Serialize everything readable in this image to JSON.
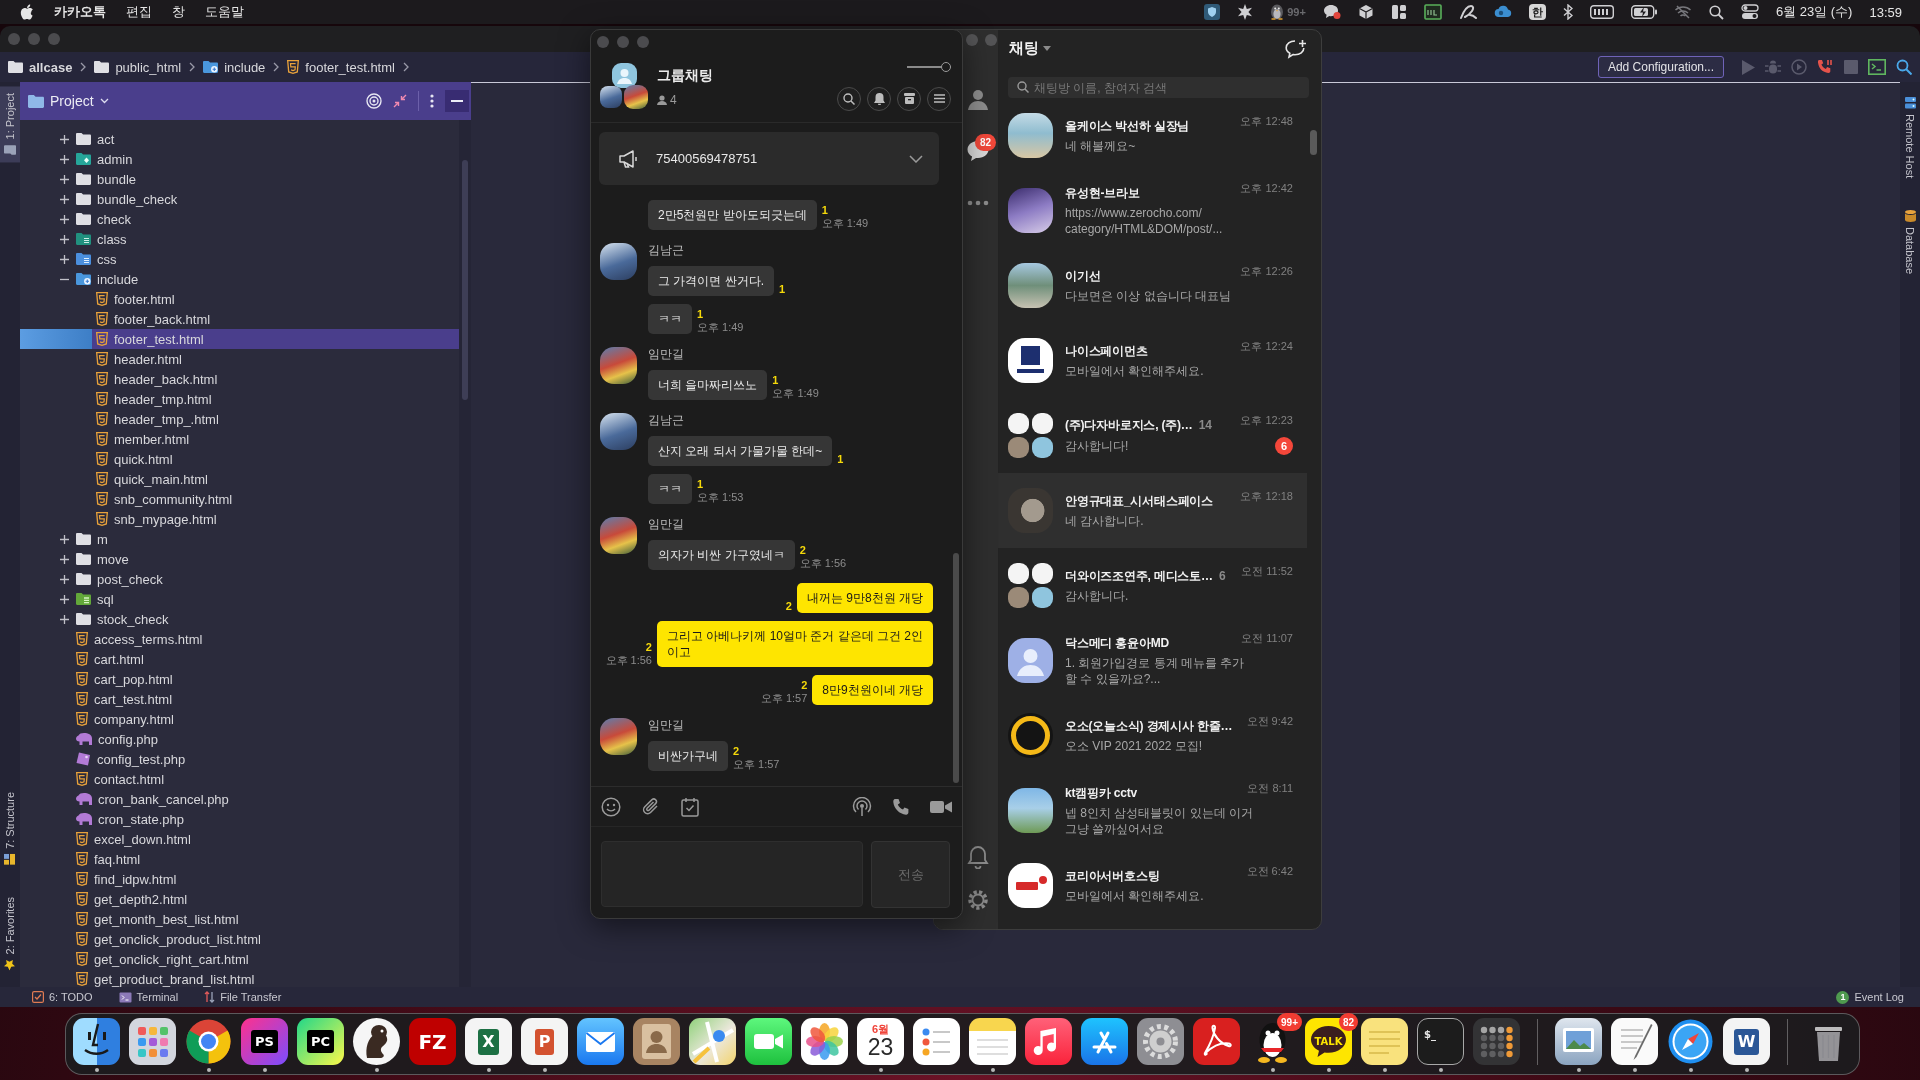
{
  "menu_bar": {
    "app": "카카오톡",
    "menus": [
      "편집",
      "창",
      "도움말"
    ],
    "status_icons": [
      {
        "kind": "shield"
      },
      {
        "kind": "spark"
      },
      {
        "kind": "penguin",
        "badge": "99+"
      },
      {
        "kind": "chat"
      },
      {
        "kind": "cube"
      },
      {
        "kind": "panels"
      },
      {
        "kind": "monitor"
      },
      {
        "kind": "swoosh"
      },
      {
        "kind": "cloud"
      },
      {
        "kind": "input",
        "label": "한"
      },
      {
        "kind": "bluetooth"
      },
      {
        "kind": "meter"
      },
      {
        "kind": "battery"
      },
      {
        "kind": "wifi_off"
      },
      {
        "kind": "search"
      },
      {
        "kind": "toggles"
      }
    ],
    "date": "6월 23일 (수)",
    "time": "13:59"
  },
  "ide": {
    "breadcrumb": [
      {
        "label": "allcase",
        "kind": "root"
      },
      {
        "label": "public_html",
        "kind": "folder"
      },
      {
        "label": "include",
        "kind": "module"
      },
      {
        "label": "footer_test.html",
        "kind": "html"
      }
    ],
    "run_config": "Add Configuration...",
    "toolbar": [
      {
        "kind": "run",
        "disabled": true
      },
      {
        "kind": "debug",
        "disabled": true
      },
      {
        "kind": "coverage",
        "disabled": true
      },
      {
        "kind": "attach",
        "disabled": false
      },
      {
        "kind": "stop",
        "disabled": true
      },
      {
        "kind": "terminal",
        "disabled": false
      },
      {
        "kind": "search",
        "disabled": false
      }
    ],
    "left_tools": {
      "top": [
        {
          "label": "1: Project",
          "kind": "project",
          "selected": true
        }
      ],
      "bottom": [
        {
          "label": "7: Structure",
          "kind": "structure",
          "selected": false
        },
        {
          "label": "2: Favorites",
          "kind": "favorites",
          "selected": false
        }
      ]
    },
    "right_tools": [
      {
        "label": "Remote Host",
        "kind": "remote",
        "selected": false
      },
      {
        "label": "Database",
        "kind": "database",
        "selected": false
      }
    ],
    "project_panel": {
      "title": "Project",
      "tree": [
        {
          "label": "act",
          "kind": "folder",
          "expanded": false,
          "selected": false
        },
        {
          "label": "admin",
          "kind": "folder_web",
          "expanded": false,
          "selected": false
        },
        {
          "label": "bundle",
          "kind": "folder",
          "expanded": false,
          "selected": false
        },
        {
          "label": "bundle_check",
          "kind": "folder",
          "expanded": false,
          "selected": false
        },
        {
          "label": "check",
          "kind": "folder",
          "expanded": false,
          "selected": false
        },
        {
          "label": "class",
          "kind": "folder_lib",
          "expanded": false,
          "selected": false
        },
        {
          "label": "css",
          "kind": "folder_css",
          "expanded": false,
          "selected": false
        },
        {
          "label": "include",
          "kind": "folder_module",
          "expanded": true,
          "selected": false,
          "children": [
            {
              "label": "footer.html",
              "kind": "html",
              "selected": false
            },
            {
              "label": "footer_back.html",
              "kind": "html",
              "selected": false
            },
            {
              "label": "footer_test.html",
              "kind": "html",
              "selected": true
            },
            {
              "label": "header.html",
              "kind": "html",
              "selected": false
            },
            {
              "label": "header_back.html",
              "kind": "html",
              "selected": false
            },
            {
              "label": "header_tmp.html",
              "kind": "html",
              "selected": false
            },
            {
              "label": "header_tmp_.html",
              "kind": "html",
              "selected": false
            },
            {
              "label": "member.html",
              "kind": "html",
              "selected": false
            },
            {
              "label": "quick.html",
              "kind": "html",
              "selected": false
            },
            {
              "label": "quick_main.html",
              "kind": "html",
              "selected": false
            },
            {
              "label": "snb_community.html",
              "kind": "html",
              "selected": false
            },
            {
              "label": "snb_mypage.html",
              "kind": "html",
              "selected": false
            }
          ]
        },
        {
          "label": "m",
          "kind": "folder",
          "expanded": false,
          "selected": false
        },
        {
          "label": "move",
          "kind": "folder",
          "expanded": false,
          "selected": false
        },
        {
          "label": "post_check",
          "kind": "folder",
          "expanded": false,
          "selected": false
        },
        {
          "label": "sql",
          "kind": "folder_db",
          "expanded": false,
          "selected": false
        },
        {
          "label": "stock_check",
          "kind": "folder",
          "expanded": false,
          "selected": false
        },
        {
          "label": "access_terms.html",
          "kind": "html",
          "selected": false
        },
        {
          "label": "cart.html",
          "kind": "html",
          "selected": false
        },
        {
          "label": "cart_pop.html",
          "kind": "html",
          "selected": false
        },
        {
          "label": "cart_test.html",
          "kind": "html",
          "selected": false
        },
        {
          "label": "company.html",
          "kind": "html",
          "selected": false
        },
        {
          "label": "config.php",
          "kind": "php",
          "selected": false
        },
        {
          "label": "config_test.php",
          "kind": "php_config",
          "selected": false
        },
        {
          "label": "contact.html",
          "kind": "html",
          "selected": false
        },
        {
          "label": "cron_bank_cancel.php",
          "kind": "php",
          "selected": false
        },
        {
          "label": "cron_state.php",
          "kind": "php",
          "selected": false
        },
        {
          "label": "excel_down.html",
          "kind": "html",
          "selected": false
        },
        {
          "label": "faq.html",
          "kind": "html",
          "selected": false
        },
        {
          "label": "find_idpw.html",
          "kind": "html",
          "selected": false
        },
        {
          "label": "get_depth2.html",
          "kind": "html",
          "selected": false
        },
        {
          "label": "get_month_best_list.html",
          "kind": "html",
          "selected": false
        },
        {
          "label": "get_onclick_product_list.html",
          "kind": "html",
          "selected": false
        },
        {
          "label": "get_onclick_right_cart.html",
          "kind": "html",
          "selected": false
        },
        {
          "label": "get_product_brand_list.html",
          "kind": "html",
          "selected": false
        }
      ]
    },
    "status_bar": {
      "tools": [
        {
          "label": "6: TODO",
          "kind": "todo",
          "selected": false
        },
        {
          "label": "Terminal",
          "kind": "terminal",
          "selected": false
        },
        {
          "label": "File Transfer",
          "kind": "transfer",
          "selected": false
        }
      ],
      "event_log": {
        "label": "Event Log",
        "count": "1"
      }
    }
  },
  "chat_list": {
    "sidebar": {
      "top": [
        {
          "kind": "friends"
        },
        {
          "kind": "chats",
          "badge": "82"
        },
        {
          "kind": "more"
        }
      ],
      "bottom": [
        {
          "kind": "bell"
        },
        {
          "kind": "settings"
        }
      ]
    },
    "title": "채팅",
    "search": {
      "placeholder": "채팅방 이름, 참여자 검색"
    },
    "rooms": [
      {
        "name": "올케이스 박선하 실장님",
        "preview": "네 해볼께요~",
        "time": "오후 12:48",
        "avatar": {
          "kind": "photo_beach"
        },
        "selected": false
      },
      {
        "name": "유성현-브라보",
        "preview": "https://www.zerocho.com/\ncategory/HTML&DOM/post/...",
        "time": "오후 12:42",
        "avatar": {
          "kind": "photo_sky"
        },
        "selected": false
      },
      {
        "name": "이기선",
        "preview": "다보면은 이상 없습니다 대표님",
        "time": "오후 12:26",
        "avatar": {
          "kind": "photo_mountain"
        },
        "selected": false
      },
      {
        "name": "나이스페이먼츠",
        "preview": "모바일에서 확인해주세요.",
        "time": "오후 12:24",
        "avatar": {
          "kind": "logo_tile"
        },
        "selected": false
      },
      {
        "name": "(주)다자바로지스, (주)…",
        "members": "14",
        "preview": "감사합니다!",
        "time": "오후 12:23",
        "unread": "6",
        "avatar": {
          "kind": "group"
        },
        "selected": false
      },
      {
        "name": "안영규대표_시서태스페이스",
        "preview": "네 감사합니다.",
        "time": "오후 12:18",
        "avatar": {
          "kind": "photo_dark"
        },
        "selected": true
      },
      {
        "name": "더와이즈조연주, 메디스토…",
        "members": "6",
        "preview": "감사합니다.",
        "time": "오전 11:52",
        "avatar": {
          "kind": "group"
        },
        "selected": false
      },
      {
        "name": "닥스메디 홍윤아MD",
        "preview": "1. 회원가입경로 통계 메뉴를 추가\n할 수 있을까요?...",
        "time": "오전 11:07",
        "avatar": {
          "kind": "default"
        },
        "selected": false
      },
      {
        "name": "오소(오늘소식) 경제시사 한줄…",
        "preview": "오소 VIP 2021 2022 모집!",
        "time": "오전 9:42",
        "avatar": {
          "kind": "logo_round"
        },
        "selected": false
      },
      {
        "name": "kt캠핑카 cctv",
        "preview": "넵 8인치 삼성태블릿이 있는데 이거\n그냥 쓸까싶어서요",
        "time": "오전 8:11",
        "avatar": {
          "kind": "photo_people"
        },
        "selected": false
      },
      {
        "name": "코리아서버호스팅",
        "preview": "모바일에서 확인해주세요.",
        "time": "오전 6:42",
        "avatar": {
          "kind": "logo_red"
        },
        "selected": false
      }
    ]
  },
  "chat_window": {
    "title": "그룹채팅",
    "member_count": "4",
    "opacity": {
      "level": 1
    },
    "header_buttons": [
      {
        "kind": "search"
      },
      {
        "kind": "bell"
      },
      {
        "kind": "drawer"
      },
      {
        "kind": "menu"
      }
    ],
    "notice": {
      "text": "75400569478751",
      "expanded": false
    },
    "messages": [
      {
        "kind": "received",
        "bubbles": [
          {
            "text": "2만5천원만 받아도되긋는데",
            "unread": "1",
            "time": "오후 1:49"
          }
        ]
      },
      {
        "kind": "received",
        "sender": "김남근",
        "avatar": {
          "kind": "photo_blue"
        },
        "bubbles": [
          {
            "text": "그 가격이면 싼거다.",
            "unread": "1"
          },
          {
            "text": "ㅋㅋ",
            "unread": "1",
            "time": "오후 1:49"
          }
        ]
      },
      {
        "kind": "received",
        "sender": "임만길",
        "avatar": {
          "kind": "photo_color"
        },
        "bubbles": [
          {
            "text": "너희 을마짜리쓰노",
            "unread": "1",
            "time": "오후 1:49"
          }
        ]
      },
      {
        "kind": "received",
        "sender": "김남근",
        "avatar": {
          "kind": "photo_blue"
        },
        "bubbles": [
          {
            "text": "산지 오래 되서 가물가물 한데~",
            "unread": "1"
          },
          {
            "text": "ㅋㅋ",
            "unread": "1",
            "time": "오후 1:53"
          }
        ]
      },
      {
        "kind": "received",
        "sender": "임만길",
        "avatar": {
          "kind": "photo_color"
        },
        "bubbles": [
          {
            "text": "의자가 비싼 가구였네ㅋ",
            "unread": "2",
            "time": "오후 1:56"
          }
        ]
      },
      {
        "kind": "sent",
        "bubbles": [
          {
            "text": "내꺼는 9만8천원 개당",
            "unread": "2"
          },
          {
            "text": "그리고 아베나키께 10얼마 준거 같은데 그건 2인\n이고",
            "unread": "2",
            "time": "오후 1:56"
          },
          {
            "text": "8만9천원이네 개당",
            "unread": "2",
            "time": "오후 1:57"
          }
        ]
      },
      {
        "kind": "received",
        "sender": "임만길",
        "avatar": {
          "kind": "photo_color"
        },
        "bubbles": [
          {
            "text": "비싼가구네",
            "unread": "2",
            "time": "오후 1:57"
          }
        ]
      }
    ],
    "input_tools": [
      {
        "kind": "emoji"
      },
      {
        "kind": "attach"
      },
      {
        "kind": "calendar"
      },
      {
        "kind": "broadcast"
      },
      {
        "kind": "phone"
      },
      {
        "kind": "video"
      }
    ],
    "send": {
      "label": "전송",
      "disabled": true
    }
  },
  "dock": {
    "apps": [
      {
        "kind": "finder",
        "running": true
      },
      {
        "kind": "launchpad",
        "running": false
      },
      {
        "kind": "chrome",
        "running": true
      },
      {
        "kind": "phpstorm",
        "glyph": "PS",
        "running": true
      },
      {
        "kind": "pycharm",
        "glyph": "PC",
        "running": false
      },
      {
        "kind": "squirrel",
        "running": true
      },
      {
        "kind": "filezilla",
        "glyph": "FZ",
        "running": false
      },
      {
        "kind": "excel",
        "glyph": "X",
        "running": true
      },
      {
        "kind": "powerpoint",
        "glyph": "P",
        "running": true
      },
      {
        "kind": "mail",
        "running": false
      },
      {
        "kind": "contacts",
        "running": false
      },
      {
        "kind": "maps",
        "running": false
      },
      {
        "kind": "facetime",
        "running": false
      },
      {
        "kind": "photos",
        "running": false
      },
      {
        "kind": "calendar",
        "month": "6월",
        "day": "23",
        "running": true
      },
      {
        "kind": "reminders",
        "running": false
      },
      {
        "kind": "notes",
        "running": true
      },
      {
        "kind": "music",
        "running": false
      },
      {
        "kind": "appstore",
        "running": false
      },
      {
        "kind": "settings",
        "running": false
      },
      {
        "kind": "acrobat",
        "running": false
      },
      {
        "kind": "qq",
        "badge": "99+",
        "running": true
      },
      {
        "kind": "kakaotalk",
        "glyph": "TALK",
        "badge": "82",
        "running": true
      },
      {
        "kind": "stickies",
        "running": true
      },
      {
        "kind": "terminal",
        "glyph": "$_",
        "running": true
      },
      {
        "kind": "calculator",
        "running": false
      }
    ],
    "recent": [
      {
        "kind": "preview",
        "running": true
      },
      {
        "kind": "textedit",
        "running": true
      },
      {
        "kind": "safari",
        "running": true
      },
      {
        "kind": "word",
        "glyph": "W",
        "running": true
      }
    ],
    "trash": {
      "kind": "trash"
    }
  }
}
